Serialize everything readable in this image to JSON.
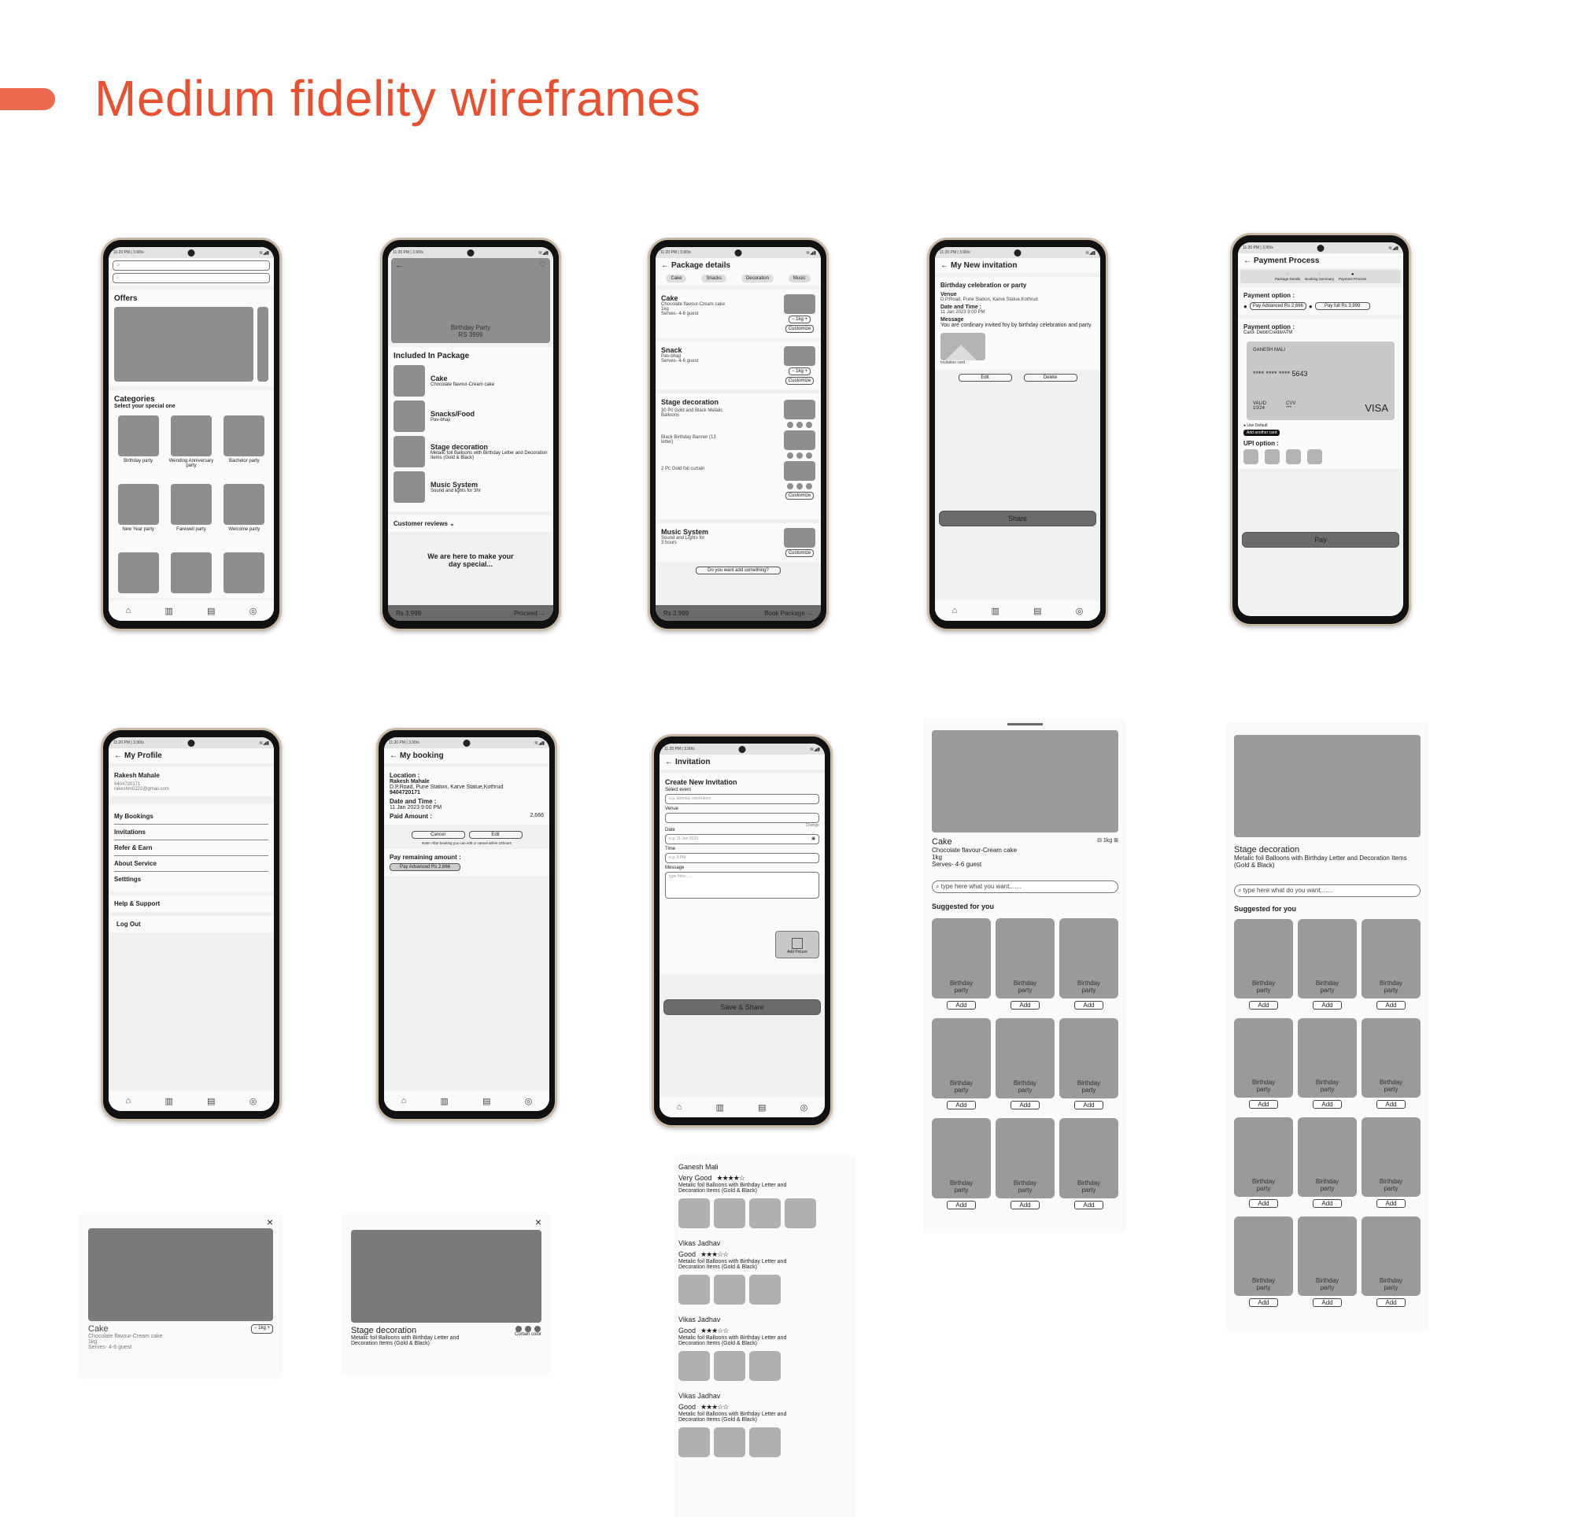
{
  "header": {
    "title": "Medium fidelity wireframes"
  },
  "status": {
    "time": "11:20 PM | 3.90/s",
    "icons": "wifi signal battery"
  },
  "nav": {
    "home": "⌂",
    "book": "▥",
    "doc": "▤",
    "profile": "◎"
  },
  "home": {
    "offers": "Offers",
    "categories": "Categories",
    "subtitle": "Select your special one",
    "items": [
      "Birthday party",
      "Wending Anniversary party",
      "Bachelor party",
      "New Year party",
      "Farewell party",
      "Welcome party"
    ]
  },
  "package": {
    "hero_title": "Birthday Party",
    "hero_price": "RS 3999",
    "included": "Included In Package",
    "items": [
      {
        "t": "Cake",
        "d": "Chocolate flavour-Cream cake"
      },
      {
        "t": "Snacks/Food",
        "d": "Pav-bhaji"
      },
      {
        "t": "Stage decoration",
        "d": "Metalic foil Balloons with Birthday Letter and Decoration Items (Gold & Black)"
      },
      {
        "t": "Music System",
        "d": "Sound and lights for 3hr"
      }
    ],
    "reviews": "Customer reviews ⌄",
    "tagline": "We are here to make your day special...",
    "price": "Rs 3,999",
    "proceed": "Proceed →"
  },
  "details": {
    "title": "Package details",
    "tabs": [
      "Cake",
      "Snacks",
      "Decoration",
      "Music"
    ],
    "cake": {
      "t": "Cake",
      "l1": "Chocolate flavour-Cream cake",
      "l2": "1kg",
      "l3": "Serves- 4-6 guest"
    },
    "snack": {
      "t": "Snack",
      "l1": "Pav-bhaji",
      "l2": "Serves- 4-6 guest"
    },
    "stage": {
      "t": "Stage decoration",
      "l1": "30 Pc Gold and Black Metalic Balloons",
      "l2": "Black Birthday Banner (13 letter)",
      "l3": "2 Pc Gold foil curtain"
    },
    "music": {
      "t": "Music System",
      "l1": "Sound and Lights for 3 hours"
    },
    "qty": "− 1kg +",
    "customize": "Customize",
    "add_more": "Do you want add something?",
    "price": "Rs 3,999",
    "book": "Book Package →"
  },
  "invite_view": {
    "title": "My New invitation",
    "event": "Birthday celebration or party",
    "venue_l": "Venue",
    "venue": "D.P.Road, Pune Station, Karve Statue,Kothrud",
    "dt_l": "Date and Time :",
    "dt": "11 Jan 2023   9:00 PM",
    "msg_l": "Message",
    "msg": "You are cordinary invited foy by birthday celebration and party",
    "card": "Invitation card",
    "edit": "Edit",
    "delete": "Delete",
    "share": "Share"
  },
  "payment": {
    "title": "Payment Process",
    "steps": [
      "Package Details",
      "Booking Summary",
      "Payment Process"
    ],
    "opt": "Payment option :",
    "adv": "Pay Advanced Rs 2,666",
    "full": "Pay full Rs 3,999",
    "card_type": "Card- Debit/Credit/ATM",
    "holder": "GANESH MALI",
    "number": "****   ****   ****   5643",
    "valid": "VALID 10/24",
    "cvv": "CVV ***",
    "brand": "VISA",
    "use_default": "Use Default",
    "add_card": "Add another card",
    "upi": "UPI option :",
    "pay": "Pay"
  },
  "profile": {
    "title": "My Profile",
    "name": "Rakesh Mahale",
    "phone": "9404720171",
    "email": "rakeshm0222@gmail.com",
    "menu": [
      "My Bookings",
      "Invitations",
      "Refer & Earn",
      "About Service",
      "Setttings"
    ],
    "help": "Help & Support",
    "logout": "Log Out"
  },
  "booking": {
    "title": "My booking",
    "loc_l": "Location :",
    "name": "Rakesh Mahale",
    "addr": "D.P.Road, Pune Station, Karve Statue,Kothrud",
    "phone": "9404720171",
    "dt_l": "Date and Time :",
    "dt": "11 Jan 2023   9:00 PM",
    "paid_l": "Paid Amount :",
    "paid": "2,666",
    "cancel": "Cancel",
    "edit": "Edit",
    "note": "Note- After booking you can edit or cancel within 24hours",
    "remain": "Pay remaining amount :",
    "pay_btn": "Pay Advanced Rs 2,666"
  },
  "create": {
    "title": "Invitation",
    "heading": "Create New Invitation",
    "event_l": "Select event",
    "event_ph": "e.g. birthday celebration",
    "venue_l": "Venue",
    "change": "Change",
    "date_l": "Date",
    "date_ph": "e.g. 11 Jan 2023",
    "time_l": "Time",
    "time_ph": "e.g. 9 PM",
    "msg_l": "Message",
    "msg_ph": "type here.......",
    "add_pic": "Add Picture",
    "save": "Save & Share"
  },
  "sheet_cake": {
    "t": "Cake",
    "l1": "Chocolate flavour-Cream cake",
    "l2": "1kg",
    "l3": "Serves- 4-6 guest",
    "qty": "1kg",
    "search": "type here what you want.......",
    "suggested": "Suggested for you",
    "item": "Birthday party",
    "add": "Add"
  },
  "sheet_stage": {
    "t": "Stage decoration",
    "d": "Metalic foil Balloons with Birthday Letter and Decoration Items (Gold & Black)",
    "search": "type here what do you want.......",
    "suggested": "Suggested for you",
    "item": "Birthday party",
    "add": "Add"
  },
  "modal_cake": {
    "t": "Cake",
    "l1": "Chocolate flavour-Cream cake",
    "l2": "1kg",
    "l3": "Serves- 4-6 guest",
    "qty": "− 1kg +"
  },
  "modal_stage": {
    "t": "Stage decoration",
    "d": "Metalic foil Balloons with Birthday Letter and Decoration Items (Gold & Black)",
    "color": "Curtain color"
  },
  "reviews": [
    {
      "name": "Ganesh Mali",
      "rating_label": "Very Good",
      "stars": 4,
      "text": "Metalic foil Balloons with Birthday Letter and Decoration Items (Gold & Black)",
      "photos": 4
    },
    {
      "name": "Vikas Jadhav",
      "rating_label": "Good",
      "stars": 3,
      "text": "Metalic foil Balloons with Birthday Letter and Decoration Items (Gold & Black)",
      "photos": 3
    },
    {
      "name": "Vikas Jadhav",
      "rating_label": "Good",
      "stars": 3,
      "text": "Metalic foil Balloons with Birthday Letter and Decoration Items (Gold & Black)",
      "photos": 3
    },
    {
      "name": "Vikas Jadhav",
      "rating_label": "Good",
      "stars": 3,
      "text": "Metalic foil Balloons with Birthday Letter and Decoration Items (Gold & Black)",
      "photos": 3
    }
  ]
}
